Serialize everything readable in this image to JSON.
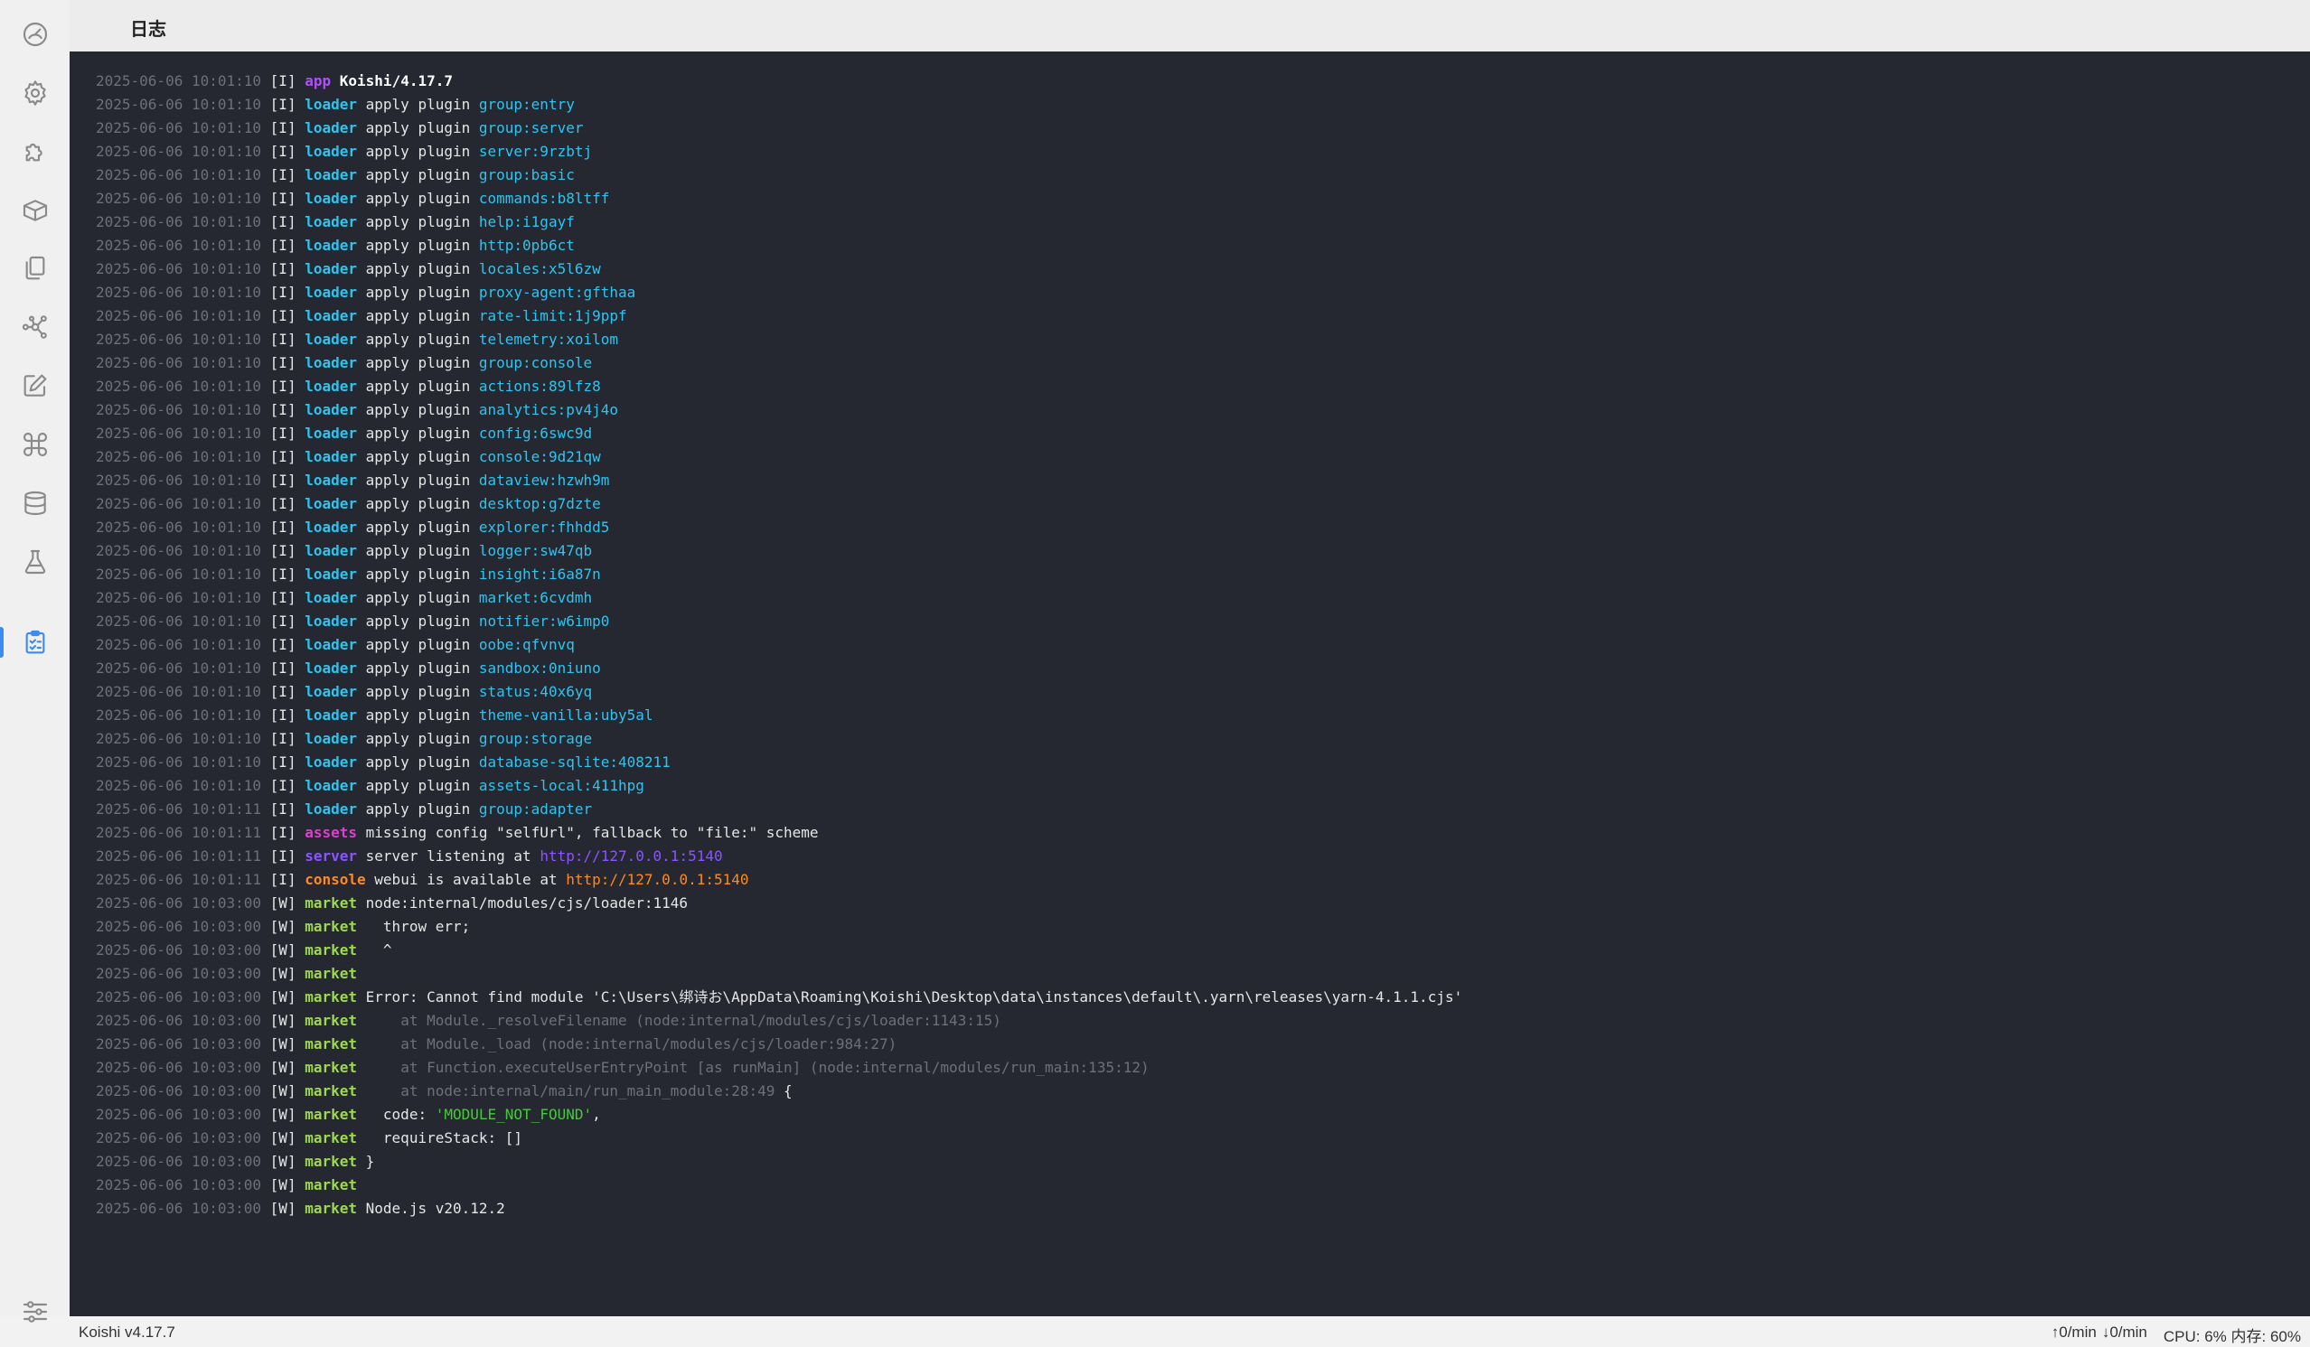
{
  "header": {
    "title": "日志"
  },
  "sidebar": {
    "items": [
      {
        "name": "dashboard-icon",
        "active": false
      },
      {
        "name": "gear-icon",
        "active": false
      },
      {
        "name": "puzzle-icon",
        "active": false
      },
      {
        "name": "package-icon",
        "active": false
      },
      {
        "name": "files-icon",
        "active": false
      },
      {
        "name": "graph-icon",
        "active": false
      },
      {
        "name": "edit-icon",
        "active": false
      },
      {
        "name": "command-icon",
        "active": false
      },
      {
        "name": "database-icon",
        "active": false
      },
      {
        "name": "flask-icon",
        "active": false
      },
      {
        "name": "clipboard-check-icon",
        "active": true
      }
    ],
    "bottom_item": {
      "name": "sliders-icon"
    }
  },
  "logs": [
    {
      "ts": "2025-06-06 10:01:10",
      "level": "[I]",
      "name": "app",
      "nc": "app",
      "segs": [
        {
          "t": " "
        },
        {
          "t": "Koishi/4.17.7",
          "c": "bold"
        }
      ]
    },
    {
      "ts": "2025-06-06 10:01:10",
      "level": "[I]",
      "name": "loader",
      "nc": "loader",
      "segs": [
        {
          "t": " apply plugin "
        },
        {
          "t": "group:entry",
          "c": "cyan"
        }
      ]
    },
    {
      "ts": "2025-06-06 10:01:10",
      "level": "[I]",
      "name": "loader",
      "nc": "loader",
      "segs": [
        {
          "t": " apply plugin "
        },
        {
          "t": "group:server",
          "c": "cyan"
        }
      ]
    },
    {
      "ts": "2025-06-06 10:01:10",
      "level": "[I]",
      "name": "loader",
      "nc": "loader",
      "segs": [
        {
          "t": " apply plugin "
        },
        {
          "t": "server:9rzbtj",
          "c": "cyan"
        }
      ]
    },
    {
      "ts": "2025-06-06 10:01:10",
      "level": "[I]",
      "name": "loader",
      "nc": "loader",
      "segs": [
        {
          "t": " apply plugin "
        },
        {
          "t": "group:basic",
          "c": "cyan"
        }
      ]
    },
    {
      "ts": "2025-06-06 10:01:10",
      "level": "[I]",
      "name": "loader",
      "nc": "loader",
      "segs": [
        {
          "t": " apply plugin "
        },
        {
          "t": "commands:b8ltff",
          "c": "cyan"
        }
      ]
    },
    {
      "ts": "2025-06-06 10:01:10",
      "level": "[I]",
      "name": "loader",
      "nc": "loader",
      "segs": [
        {
          "t": " apply plugin "
        },
        {
          "t": "help:i1gayf",
          "c": "cyan"
        }
      ]
    },
    {
      "ts": "2025-06-06 10:01:10",
      "level": "[I]",
      "name": "loader",
      "nc": "loader",
      "segs": [
        {
          "t": " apply plugin "
        },
        {
          "t": "http:0pb6ct",
          "c": "cyan"
        }
      ]
    },
    {
      "ts": "2025-06-06 10:01:10",
      "level": "[I]",
      "name": "loader",
      "nc": "loader",
      "segs": [
        {
          "t": " apply plugin "
        },
        {
          "t": "locales:x5l6zw",
          "c": "cyan"
        }
      ]
    },
    {
      "ts": "2025-06-06 10:01:10",
      "level": "[I]",
      "name": "loader",
      "nc": "loader",
      "segs": [
        {
          "t": " apply plugin "
        },
        {
          "t": "proxy-agent:gfthaa",
          "c": "cyan"
        }
      ]
    },
    {
      "ts": "2025-06-06 10:01:10",
      "level": "[I]",
      "name": "loader",
      "nc": "loader",
      "segs": [
        {
          "t": " apply plugin "
        },
        {
          "t": "rate-limit:1j9ppf",
          "c": "cyan"
        }
      ]
    },
    {
      "ts": "2025-06-06 10:01:10",
      "level": "[I]",
      "name": "loader",
      "nc": "loader",
      "segs": [
        {
          "t": " apply plugin "
        },
        {
          "t": "telemetry:xoilom",
          "c": "cyan"
        }
      ]
    },
    {
      "ts": "2025-06-06 10:01:10",
      "level": "[I]",
      "name": "loader",
      "nc": "loader",
      "segs": [
        {
          "t": " apply plugin "
        },
        {
          "t": "group:console",
          "c": "cyan"
        }
      ]
    },
    {
      "ts": "2025-06-06 10:01:10",
      "level": "[I]",
      "name": "loader",
      "nc": "loader",
      "segs": [
        {
          "t": " apply plugin "
        },
        {
          "t": "actions:89lfz8",
          "c": "cyan"
        }
      ]
    },
    {
      "ts": "2025-06-06 10:01:10",
      "level": "[I]",
      "name": "loader",
      "nc": "loader",
      "segs": [
        {
          "t": " apply plugin "
        },
        {
          "t": "analytics:pv4j4o",
          "c": "cyan"
        }
      ]
    },
    {
      "ts": "2025-06-06 10:01:10",
      "level": "[I]",
      "name": "loader",
      "nc": "loader",
      "segs": [
        {
          "t": " apply plugin "
        },
        {
          "t": "config:6swc9d",
          "c": "cyan"
        }
      ]
    },
    {
      "ts": "2025-06-06 10:01:10",
      "level": "[I]",
      "name": "loader",
      "nc": "loader",
      "segs": [
        {
          "t": " apply plugin "
        },
        {
          "t": "console:9d21qw",
          "c": "cyan"
        }
      ]
    },
    {
      "ts": "2025-06-06 10:01:10",
      "level": "[I]",
      "name": "loader",
      "nc": "loader",
      "segs": [
        {
          "t": " apply plugin "
        },
        {
          "t": "dataview:hzwh9m",
          "c": "cyan"
        }
      ]
    },
    {
      "ts": "2025-06-06 10:01:10",
      "level": "[I]",
      "name": "loader",
      "nc": "loader",
      "segs": [
        {
          "t": " apply plugin "
        },
        {
          "t": "desktop:g7dzte",
          "c": "cyan"
        }
      ]
    },
    {
      "ts": "2025-06-06 10:01:10",
      "level": "[I]",
      "name": "loader",
      "nc": "loader",
      "segs": [
        {
          "t": " apply plugin "
        },
        {
          "t": "explorer:fhhdd5",
          "c": "cyan"
        }
      ]
    },
    {
      "ts": "2025-06-06 10:01:10",
      "level": "[I]",
      "name": "loader",
      "nc": "loader",
      "segs": [
        {
          "t": " apply plugin "
        },
        {
          "t": "logger:sw47qb",
          "c": "cyan"
        }
      ]
    },
    {
      "ts": "2025-06-06 10:01:10",
      "level": "[I]",
      "name": "loader",
      "nc": "loader",
      "segs": [
        {
          "t": " apply plugin "
        },
        {
          "t": "insight:i6a87n",
          "c": "cyan"
        }
      ]
    },
    {
      "ts": "2025-06-06 10:01:10",
      "level": "[I]",
      "name": "loader",
      "nc": "loader",
      "segs": [
        {
          "t": " apply plugin "
        },
        {
          "t": "market:6cvdmh",
          "c": "cyan"
        }
      ]
    },
    {
      "ts": "2025-06-06 10:01:10",
      "level": "[I]",
      "name": "loader",
      "nc": "loader",
      "segs": [
        {
          "t": " apply plugin "
        },
        {
          "t": "notifier:w6imp0",
          "c": "cyan"
        }
      ]
    },
    {
      "ts": "2025-06-06 10:01:10",
      "level": "[I]",
      "name": "loader",
      "nc": "loader",
      "segs": [
        {
          "t": " apply plugin "
        },
        {
          "t": "oobe:qfvnvq",
          "c": "cyan"
        }
      ]
    },
    {
      "ts": "2025-06-06 10:01:10",
      "level": "[I]",
      "name": "loader",
      "nc": "loader",
      "segs": [
        {
          "t": " apply plugin "
        },
        {
          "t": "sandbox:0niuno",
          "c": "cyan"
        }
      ]
    },
    {
      "ts": "2025-06-06 10:01:10",
      "level": "[I]",
      "name": "loader",
      "nc": "loader",
      "segs": [
        {
          "t": " apply plugin "
        },
        {
          "t": "status:40x6yq",
          "c": "cyan"
        }
      ]
    },
    {
      "ts": "2025-06-06 10:01:10",
      "level": "[I]",
      "name": "loader",
      "nc": "loader",
      "segs": [
        {
          "t": " apply plugin "
        },
        {
          "t": "theme-vanilla:uby5al",
          "c": "cyan"
        }
      ]
    },
    {
      "ts": "2025-06-06 10:01:10",
      "level": "[I]",
      "name": "loader",
      "nc": "loader",
      "segs": [
        {
          "t": " apply plugin "
        },
        {
          "t": "group:storage",
          "c": "cyan"
        }
      ]
    },
    {
      "ts": "2025-06-06 10:01:10",
      "level": "[I]",
      "name": "loader",
      "nc": "loader",
      "segs": [
        {
          "t": " apply plugin "
        },
        {
          "t": "database-sqlite:408211",
          "c": "cyan"
        }
      ]
    },
    {
      "ts": "2025-06-06 10:01:10",
      "level": "[I]",
      "name": "loader",
      "nc": "loader",
      "segs": [
        {
          "t": " apply plugin "
        },
        {
          "t": "assets-local:411hpg",
          "c": "cyan"
        }
      ]
    },
    {
      "ts": "2025-06-06 10:01:11",
      "level": "[I]",
      "name": "loader",
      "nc": "loader",
      "segs": [
        {
          "t": " apply plugin "
        },
        {
          "t": "group:adapter",
          "c": "cyan"
        }
      ]
    },
    {
      "ts": "2025-06-06 10:01:11",
      "level": "[I]",
      "name": "assets",
      "nc": "assets",
      "segs": [
        {
          "t": " missing config \"selfUrl\", fallback to \"file:\" scheme"
        }
      ]
    },
    {
      "ts": "2025-06-06 10:01:11",
      "level": "[I]",
      "name": "server",
      "nc": "server",
      "segs": [
        {
          "t": " server listening at "
        },
        {
          "t": "http://127.0.0.1:5140",
          "c": "purple"
        }
      ]
    },
    {
      "ts": "2025-06-06 10:01:11",
      "level": "[I]",
      "name": "console",
      "nc": "console",
      "segs": [
        {
          "t": " webui is available at "
        },
        {
          "t": "http://127.0.0.1:5140",
          "c": "orange"
        }
      ]
    },
    {
      "ts": "2025-06-06 10:03:00",
      "level": "[W]",
      "name": "market",
      "nc": "market",
      "segs": [
        {
          "t": " node:internal/modules/cjs/loader:1146"
        }
      ]
    },
    {
      "ts": "2025-06-06 10:03:00",
      "level": "[W]",
      "name": "market",
      "nc": "market",
      "segs": [
        {
          "t": "   throw err;"
        }
      ]
    },
    {
      "ts": "2025-06-06 10:03:00",
      "level": "[W]",
      "name": "market",
      "nc": "market",
      "segs": [
        {
          "t": "   ^"
        }
      ]
    },
    {
      "ts": "2025-06-06 10:03:00",
      "level": "[W]",
      "name": "market",
      "nc": "market",
      "segs": [
        {
          "t": ""
        }
      ]
    },
    {
      "ts": "2025-06-06 10:03:00",
      "level": "[W]",
      "name": "market",
      "nc": "market",
      "segs": [
        {
          "t": " Error: Cannot find module 'C:\\Users\\绑诗お\\AppData\\Roaming\\Koishi\\Desktop\\data\\instances\\default\\.yarn\\releases\\yarn-4.1.1.cjs'"
        }
      ]
    },
    {
      "ts": "2025-06-06 10:03:00",
      "level": "[W]",
      "name": "market",
      "nc": "market",
      "segs": [
        {
          "t": "     "
        },
        {
          "t": "at Module._resolveFilename (node:internal/modules/cjs/loader:1143:15)",
          "c": "dim"
        }
      ]
    },
    {
      "ts": "2025-06-06 10:03:00",
      "level": "[W]",
      "name": "market",
      "nc": "market",
      "segs": [
        {
          "t": "     "
        },
        {
          "t": "at Module._load (node:internal/modules/cjs/loader:984:27)",
          "c": "dim"
        }
      ]
    },
    {
      "ts": "2025-06-06 10:03:00",
      "level": "[W]",
      "name": "market",
      "nc": "market",
      "segs": [
        {
          "t": "     "
        },
        {
          "t": "at Function.executeUserEntryPoint [as runMain] (node:internal/modules/run_main:135:12)",
          "c": "dim"
        }
      ]
    },
    {
      "ts": "2025-06-06 10:03:00",
      "level": "[W]",
      "name": "market",
      "nc": "market",
      "segs": [
        {
          "t": "     "
        },
        {
          "t": "at node:internal/main/run_main_module:28:49",
          "c": "dim"
        },
        {
          "t": " {"
        }
      ]
    },
    {
      "ts": "2025-06-06 10:03:00",
      "level": "[W]",
      "name": "market",
      "nc": "market",
      "segs": [
        {
          "t": "   code: "
        },
        {
          "t": "'MODULE_NOT_FOUND'",
          "c": "green"
        },
        {
          "t": ","
        }
      ]
    },
    {
      "ts": "2025-06-06 10:03:00",
      "level": "[W]",
      "name": "market",
      "nc": "market",
      "segs": [
        {
          "t": "   requireStack: []"
        }
      ]
    },
    {
      "ts": "2025-06-06 10:03:00",
      "level": "[W]",
      "name": "market",
      "nc": "market",
      "segs": [
        {
          "t": " }"
        }
      ]
    },
    {
      "ts": "2025-06-06 10:03:00",
      "level": "[W]",
      "name": "market",
      "nc": "market",
      "segs": [
        {
          "t": ""
        }
      ]
    },
    {
      "ts": "2025-06-06 10:03:00",
      "level": "[W]",
      "name": "market",
      "nc": "market",
      "segs": [
        {
          "t": " Node.js v20.12.2"
        }
      ]
    }
  ],
  "status": {
    "version": "Koishi v4.17.7",
    "upload": "↑0/min",
    "download": "↓0/min",
    "usage": "CPU: 6% 内存: 60%"
  },
  "colors": {
    "log_bg": "#252830",
    "accent": "#3c8cf0",
    "timestamp": "#6d7079",
    "loader": "#2fc4ef",
    "market": "#9ed84f",
    "app": "#b24dff",
    "assets": "#e23cd6",
    "server": "#8a55ff",
    "console": "#ff8a1f"
  }
}
